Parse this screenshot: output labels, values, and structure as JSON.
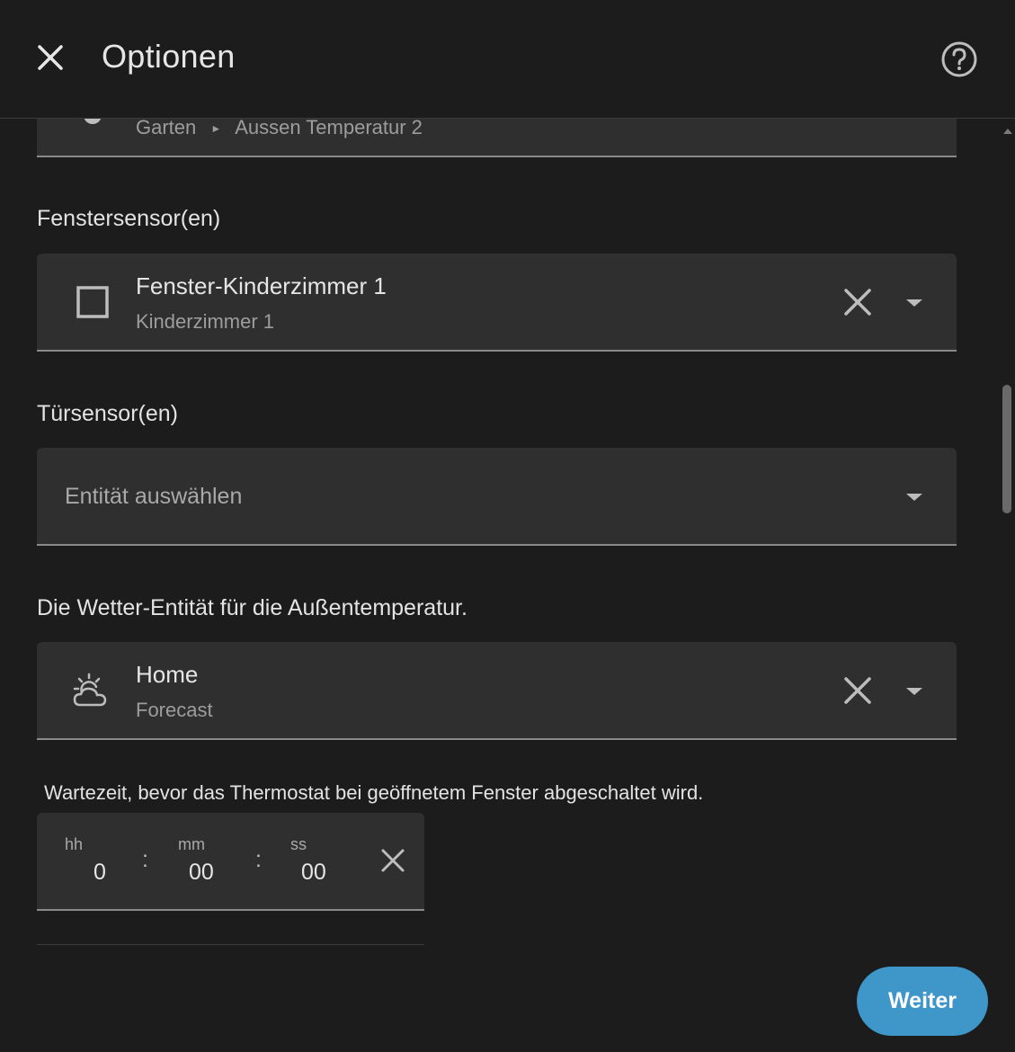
{
  "header": {
    "title": "Optionen"
  },
  "outdoor_sensor": {
    "area": "Garten",
    "entity": "Aussen Temperatur 2"
  },
  "window_sensors": {
    "label": "Fenstersensor(en)",
    "selected_name": "Fenster-Kinderzimmer 1",
    "selected_area": "Kinderzimmer 1"
  },
  "door_sensors": {
    "label": "Türsensor(en)",
    "placeholder": "Entität auswählen"
  },
  "weather_entity": {
    "label": "Die Wetter-Entität für die Außentemperatur.",
    "selected_name": "Home",
    "selected_sub": "Forecast"
  },
  "window_delay": {
    "label": "Wartezeit, bevor das Thermostat bei geöffnetem Fenster abgeschaltet wird.",
    "hours_label": "hh",
    "minutes_label": "mm",
    "seconds_label": "ss",
    "hours": "0",
    "minutes": "00",
    "seconds": "00",
    "separator": ":"
  },
  "footer": {
    "next_label": "Weiter"
  },
  "colors": {
    "background": "#1c1c1c",
    "field": "#2f2f2f",
    "accent": "#3f97c9"
  },
  "icons": {
    "close": "close-icon",
    "help": "help-circle-icon",
    "window": "window-icon",
    "weather": "weather-partly-cloudy-icon",
    "clear": "clear-icon",
    "dropdown": "chevron-down-icon"
  }
}
